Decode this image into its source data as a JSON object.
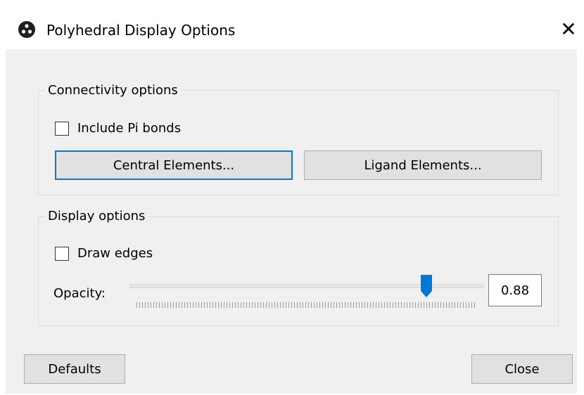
{
  "window": {
    "title": "Polyhedral Display Options",
    "close_glyph": "✕"
  },
  "connectivity": {
    "group_title": "Connectivity options",
    "include_pi_label": "Include Pi bonds",
    "include_pi_checked": false,
    "central_button": "Central Elements...",
    "ligand_button": "Ligand Elements..."
  },
  "display": {
    "group_title": "Display options",
    "draw_edges_label": "Draw edges",
    "draw_edges_checked": false,
    "opacity_label": "Opacity:",
    "opacity_value": "0.88",
    "opacity_fraction": 0.88
  },
  "footer": {
    "defaults_button": "Defaults",
    "close_button": "Close"
  },
  "icons": {
    "app": "molecule-icon",
    "close": "close-icon",
    "slider_thumb": "slider-thumb-icon"
  },
  "colors": {
    "accent": "#0078d7",
    "dialog_bg": "#f0f0f0",
    "button_bg": "#e1e1e1"
  }
}
